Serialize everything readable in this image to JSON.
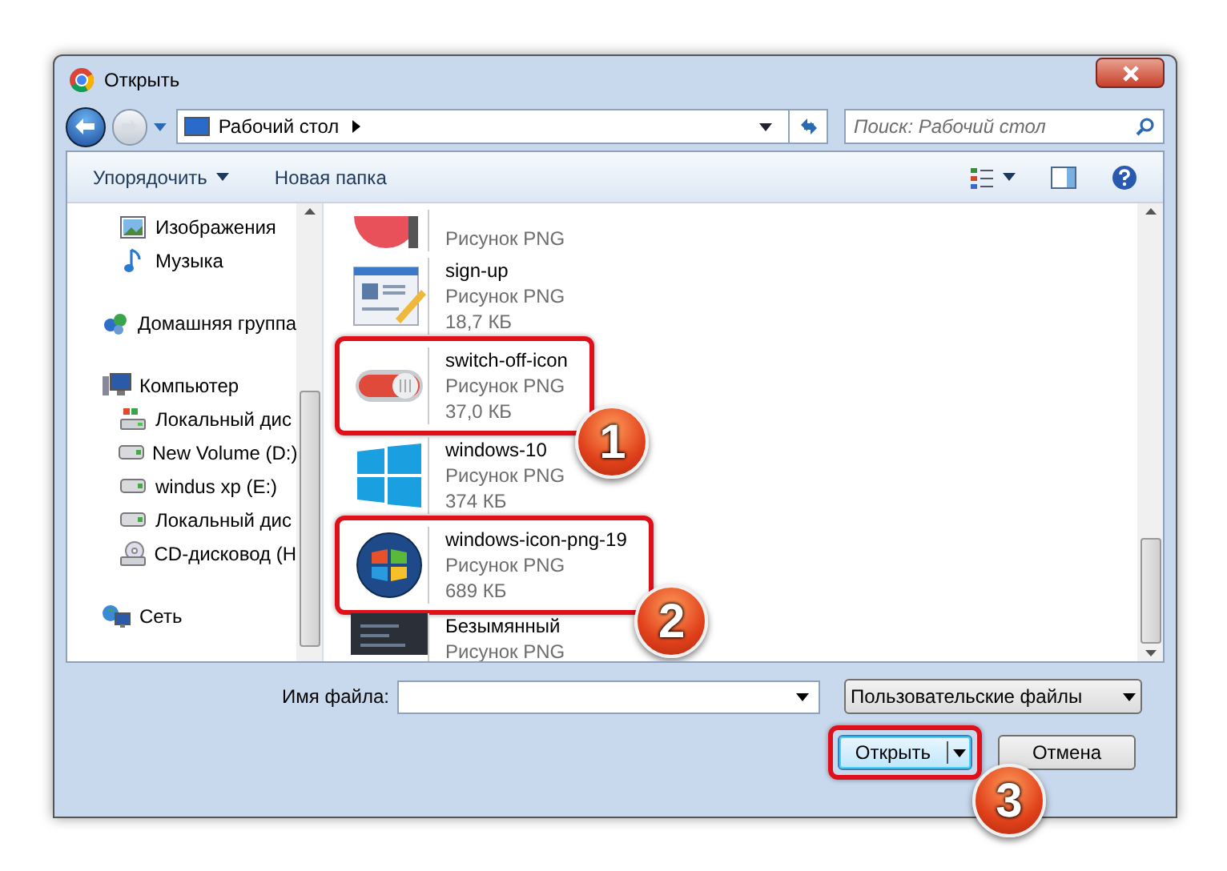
{
  "window": {
    "title": "Открыть"
  },
  "nav": {
    "location": "Рабочий стол",
    "search": {
      "placeholder": "Поиск: Рабочий стол"
    }
  },
  "toolbar": {
    "organize": "Упорядочить",
    "new_folder": "Новая папка"
  },
  "sidebar": {
    "items": [
      {
        "label": "Изображения",
        "kind": "pictures"
      },
      {
        "label": "Музыка",
        "kind": "music"
      },
      {
        "label": "Домашняя группа",
        "kind": "homegroup"
      },
      {
        "label": "Компьютер",
        "kind": "computer",
        "children": [
          {
            "label": "Локальный дис",
            "kind": "windrive"
          },
          {
            "label": "New Volume (D:)",
            "kind": "drive"
          },
          {
            "label": "windus xp (E:)",
            "kind": "drive"
          },
          {
            "label": "Локальный дис",
            "kind": "drive"
          },
          {
            "label": "CD-дисковод (H",
            "kind": "cd"
          }
        ]
      },
      {
        "label": "Сеть",
        "kind": "network"
      }
    ]
  },
  "files": [
    {
      "type": "Рисунок PNG",
      "kind": "palette",
      "highlighted": false
    },
    {
      "name": "sign-up",
      "type": "Рисунок PNG",
      "size": "18,7 КБ",
      "kind": "signup",
      "highlighted": false
    },
    {
      "name": "switch-off-icon",
      "type": "Рисунок PNG",
      "size": "37,0 КБ",
      "kind": "switch",
      "highlighted": true,
      "callout": "1"
    },
    {
      "name": "windows-10",
      "type": "Рисунок PNG",
      "size": "374 КБ",
      "kind": "win10",
      "highlighted": false
    },
    {
      "name": "windows-icon-png-19",
      "type": "Рисунок PNG",
      "size": "689 КБ",
      "kind": "win7",
      "highlighted": true,
      "callout": "2"
    },
    {
      "name": "Безымянный",
      "type": "Рисунок PNG",
      "kind": "screenshot",
      "highlighted": false
    }
  ],
  "footer": {
    "filename_label": "Имя файла:",
    "filter": "Пользовательские файлы",
    "open_button": {
      "label": "Открыть",
      "highlighted": true,
      "callout": "3"
    },
    "cancel_button": "Отмена"
  }
}
